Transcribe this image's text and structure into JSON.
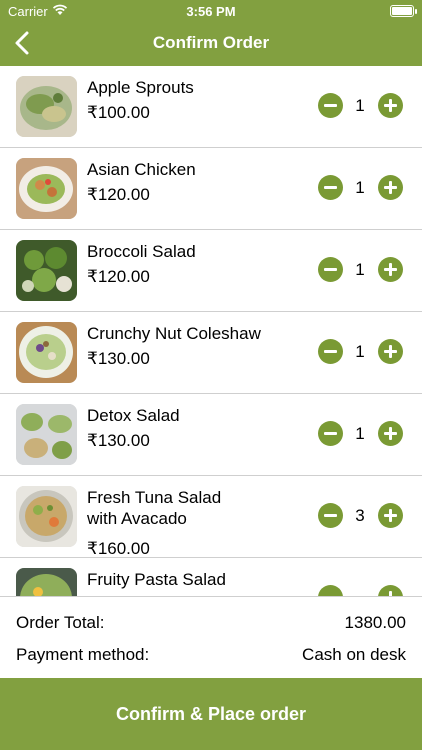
{
  "status": {
    "carrier": "Carrier",
    "time": "3:56 PM"
  },
  "header": {
    "title": "Confirm Order",
    "back_icon": "chevron-left-icon"
  },
  "colors": {
    "brand_green": "#82a040",
    "button_green": "#7a9a34",
    "divider": "#cfcfcf"
  },
  "items": [
    {
      "name": "Apple Sprouts",
      "price": "₹100.00",
      "qty": "1"
    },
    {
      "name": "Asian Chicken",
      "price": "₹120.00",
      "qty": "1"
    },
    {
      "name": "Broccoli Salad",
      "price": "₹120.00",
      "qty": "1"
    },
    {
      "name": "Crunchy Nut Coleshaw",
      "price": "₹130.00",
      "qty": "1"
    },
    {
      "name": "Detox Salad",
      "price": "₹130.00",
      "qty": "1"
    },
    {
      "name": "Fresh Tuna Salad with Avacado",
      "price": "₹160.00",
      "qty": "3"
    },
    {
      "name": "Fruity Pasta Salad",
      "price": "",
      "qty": ""
    }
  ],
  "summary": {
    "total_label": "Order Total:",
    "total_value": "1380.00",
    "payment_label": "Payment method:",
    "payment_value": "Cash on desk"
  },
  "action": {
    "confirm_label": "Confirm & Place order"
  }
}
